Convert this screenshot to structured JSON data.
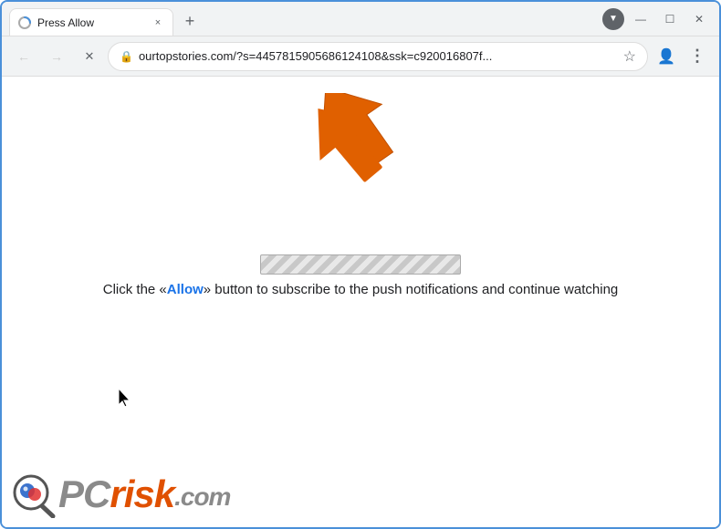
{
  "window": {
    "title": "Press Allow",
    "favicon": "loading",
    "tab_close_label": "×",
    "tab_new_label": "+",
    "controls": {
      "minimize": "—",
      "maximize": "☐",
      "close": "✕"
    }
  },
  "address_bar": {
    "url": "ourtopstories.com/?s=4457815905686124108&ssk=c920016807f...",
    "lock_icon": "🔒",
    "star_icon": "☆",
    "profile_icon": "👤",
    "menu_icon": "⋮",
    "back_icon": "←",
    "forward_icon": "→",
    "reload_icon": "✕"
  },
  "page": {
    "main_text_before": "Click the «",
    "main_text_allow": "Allow",
    "main_text_after": "» button to subscribe to the push notifications and continue watching"
  },
  "pcrisk": {
    "pc": "PC",
    "risk": "risk",
    "dotcom": ".com"
  },
  "tab_strip": {
    "dropdown_icon": "▼"
  }
}
